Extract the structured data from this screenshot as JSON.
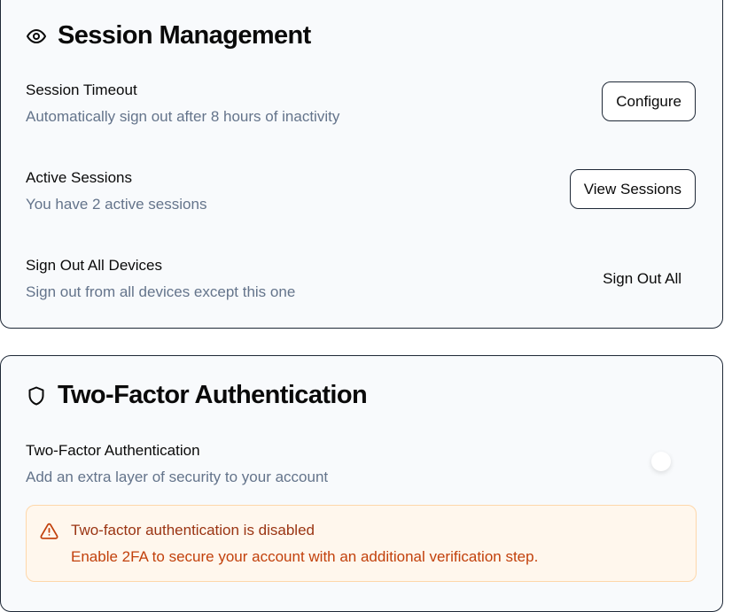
{
  "session": {
    "icon": "eye-icon",
    "title": "Session Management",
    "rows": [
      {
        "title": "Session Timeout",
        "desc": "Automatically sign out after 8 hours of inactivity",
        "button": "Configure"
      },
      {
        "title": "Active Sessions",
        "desc": "You have 2 active sessions",
        "button": "View Sessions"
      },
      {
        "title": "Sign Out All Devices",
        "desc": "Sign out from all devices except this one",
        "button": "Sign Out All"
      }
    ]
  },
  "twofa": {
    "icon": "shield-icon",
    "title": "Two-Factor Authentication",
    "row": {
      "title": "Two-Factor Authentication",
      "desc": "Add an extra layer of security to your account",
      "enabled": false
    },
    "alert": {
      "icon": "warning-icon",
      "title": "Two-factor authentication is disabled",
      "desc": "Enable 2FA to secure your account with an additional verification step.",
      "color": "#c2410c",
      "background": "#fff7ed"
    }
  }
}
